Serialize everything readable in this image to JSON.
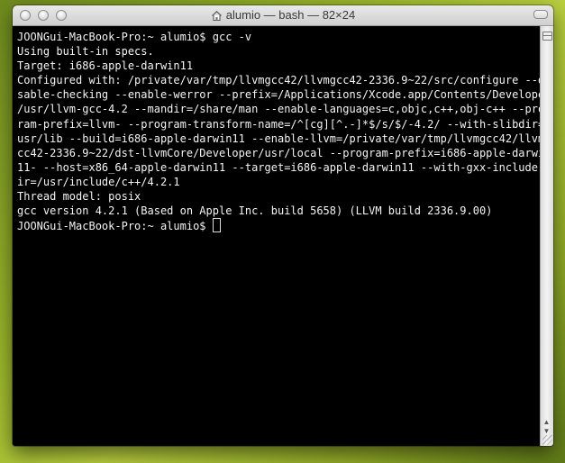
{
  "window": {
    "title": "alumio — bash — 82×24",
    "icon": "house-icon"
  },
  "terminal": {
    "lines": [
      "JOONGui-MacBook-Pro:~ alumio$ gcc -v",
      "Using built-in specs.",
      "Target: i686-apple-darwin11",
      "Configured with: /private/var/tmp/llvmgcc42/llvmgcc42-2336.9~22/src/configure --di",
      "sable-checking --enable-werror --prefix=/Applications/Xcode.app/Contents/Developer",
      "/usr/llvm-gcc-4.2 --mandir=/share/man --enable-languages=c,objc,c++,obj-c++ --prog",
      "ram-prefix=llvm- --program-transform-name=/^[cg][^.-]*$/s/$/-4.2/ --with-slibdir=/",
      "usr/lib --build=i686-apple-darwin11 --enable-llvm=/private/var/tmp/llvmgcc42/llvmg",
      "cc42-2336.9~22/dst-llvmCore/Developer/usr/local --program-prefix=i686-apple-darwin",
      "11- --host=x86_64-apple-darwin11 --target=i686-apple-darwin11 --with-gxx-include-d",
      "ir=/usr/include/c++/4.2.1",
      "Thread model: posix",
      "gcc version 4.2.1 (Based on Apple Inc. build 5658) (LLVM build 2336.9.00)"
    ],
    "prompt": "JOONGui-MacBook-Pro:~ alumio$ "
  },
  "colors": {
    "terminal_bg": "#000000",
    "terminal_fg": "#f4f4f4"
  }
}
